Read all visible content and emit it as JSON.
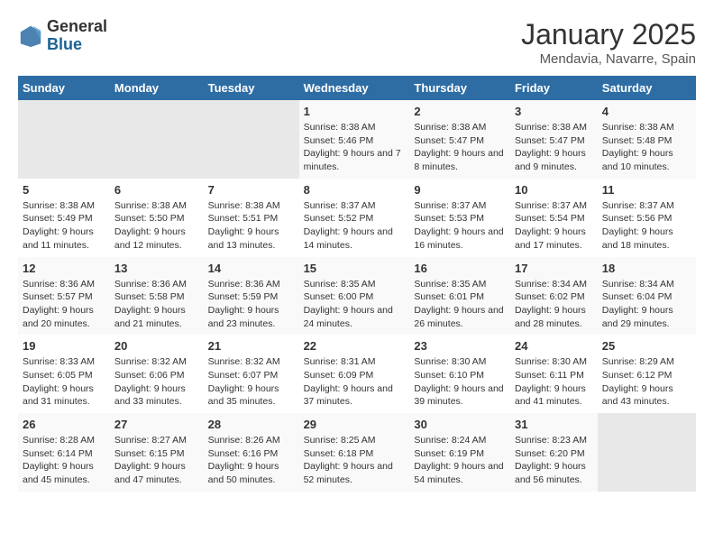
{
  "header": {
    "logo_general": "General",
    "logo_blue": "Blue",
    "month_title": "January 2025",
    "location": "Mendavia, Navarre, Spain"
  },
  "weekdays": [
    "Sunday",
    "Monday",
    "Tuesday",
    "Wednesday",
    "Thursday",
    "Friday",
    "Saturday"
  ],
  "weeks": [
    [
      {
        "day": "",
        "info": ""
      },
      {
        "day": "",
        "info": ""
      },
      {
        "day": "",
        "info": ""
      },
      {
        "day": "1",
        "info": "Sunrise: 8:38 AM\nSunset: 5:46 PM\nDaylight: 9 hours and 7 minutes."
      },
      {
        "day": "2",
        "info": "Sunrise: 8:38 AM\nSunset: 5:47 PM\nDaylight: 9 hours and 8 minutes."
      },
      {
        "day": "3",
        "info": "Sunrise: 8:38 AM\nSunset: 5:47 PM\nDaylight: 9 hours and 9 minutes."
      },
      {
        "day": "4",
        "info": "Sunrise: 8:38 AM\nSunset: 5:48 PM\nDaylight: 9 hours and 10 minutes."
      }
    ],
    [
      {
        "day": "5",
        "info": "Sunrise: 8:38 AM\nSunset: 5:49 PM\nDaylight: 9 hours and 11 minutes."
      },
      {
        "day": "6",
        "info": "Sunrise: 8:38 AM\nSunset: 5:50 PM\nDaylight: 9 hours and 12 minutes."
      },
      {
        "day": "7",
        "info": "Sunrise: 8:38 AM\nSunset: 5:51 PM\nDaylight: 9 hours and 13 minutes."
      },
      {
        "day": "8",
        "info": "Sunrise: 8:37 AM\nSunset: 5:52 PM\nDaylight: 9 hours and 14 minutes."
      },
      {
        "day": "9",
        "info": "Sunrise: 8:37 AM\nSunset: 5:53 PM\nDaylight: 9 hours and 16 minutes."
      },
      {
        "day": "10",
        "info": "Sunrise: 8:37 AM\nSunset: 5:54 PM\nDaylight: 9 hours and 17 minutes."
      },
      {
        "day": "11",
        "info": "Sunrise: 8:37 AM\nSunset: 5:56 PM\nDaylight: 9 hours and 18 minutes."
      }
    ],
    [
      {
        "day": "12",
        "info": "Sunrise: 8:36 AM\nSunset: 5:57 PM\nDaylight: 9 hours and 20 minutes."
      },
      {
        "day": "13",
        "info": "Sunrise: 8:36 AM\nSunset: 5:58 PM\nDaylight: 9 hours and 21 minutes."
      },
      {
        "day": "14",
        "info": "Sunrise: 8:36 AM\nSunset: 5:59 PM\nDaylight: 9 hours and 23 minutes."
      },
      {
        "day": "15",
        "info": "Sunrise: 8:35 AM\nSunset: 6:00 PM\nDaylight: 9 hours and 24 minutes."
      },
      {
        "day": "16",
        "info": "Sunrise: 8:35 AM\nSunset: 6:01 PM\nDaylight: 9 hours and 26 minutes."
      },
      {
        "day": "17",
        "info": "Sunrise: 8:34 AM\nSunset: 6:02 PM\nDaylight: 9 hours and 28 minutes."
      },
      {
        "day": "18",
        "info": "Sunrise: 8:34 AM\nSunset: 6:04 PM\nDaylight: 9 hours and 29 minutes."
      }
    ],
    [
      {
        "day": "19",
        "info": "Sunrise: 8:33 AM\nSunset: 6:05 PM\nDaylight: 9 hours and 31 minutes."
      },
      {
        "day": "20",
        "info": "Sunrise: 8:32 AM\nSunset: 6:06 PM\nDaylight: 9 hours and 33 minutes."
      },
      {
        "day": "21",
        "info": "Sunrise: 8:32 AM\nSunset: 6:07 PM\nDaylight: 9 hours and 35 minutes."
      },
      {
        "day": "22",
        "info": "Sunrise: 8:31 AM\nSunset: 6:09 PM\nDaylight: 9 hours and 37 minutes."
      },
      {
        "day": "23",
        "info": "Sunrise: 8:30 AM\nSunset: 6:10 PM\nDaylight: 9 hours and 39 minutes."
      },
      {
        "day": "24",
        "info": "Sunrise: 8:30 AM\nSunset: 6:11 PM\nDaylight: 9 hours and 41 minutes."
      },
      {
        "day": "25",
        "info": "Sunrise: 8:29 AM\nSunset: 6:12 PM\nDaylight: 9 hours and 43 minutes."
      }
    ],
    [
      {
        "day": "26",
        "info": "Sunrise: 8:28 AM\nSunset: 6:14 PM\nDaylight: 9 hours and 45 minutes."
      },
      {
        "day": "27",
        "info": "Sunrise: 8:27 AM\nSunset: 6:15 PM\nDaylight: 9 hours and 47 minutes."
      },
      {
        "day": "28",
        "info": "Sunrise: 8:26 AM\nSunset: 6:16 PM\nDaylight: 9 hours and 50 minutes."
      },
      {
        "day": "29",
        "info": "Sunrise: 8:25 AM\nSunset: 6:18 PM\nDaylight: 9 hours and 52 minutes."
      },
      {
        "day": "30",
        "info": "Sunrise: 8:24 AM\nSunset: 6:19 PM\nDaylight: 9 hours and 54 minutes."
      },
      {
        "day": "31",
        "info": "Sunrise: 8:23 AM\nSunset: 6:20 PM\nDaylight: 9 hours and 56 minutes."
      },
      {
        "day": "",
        "info": ""
      }
    ]
  ]
}
